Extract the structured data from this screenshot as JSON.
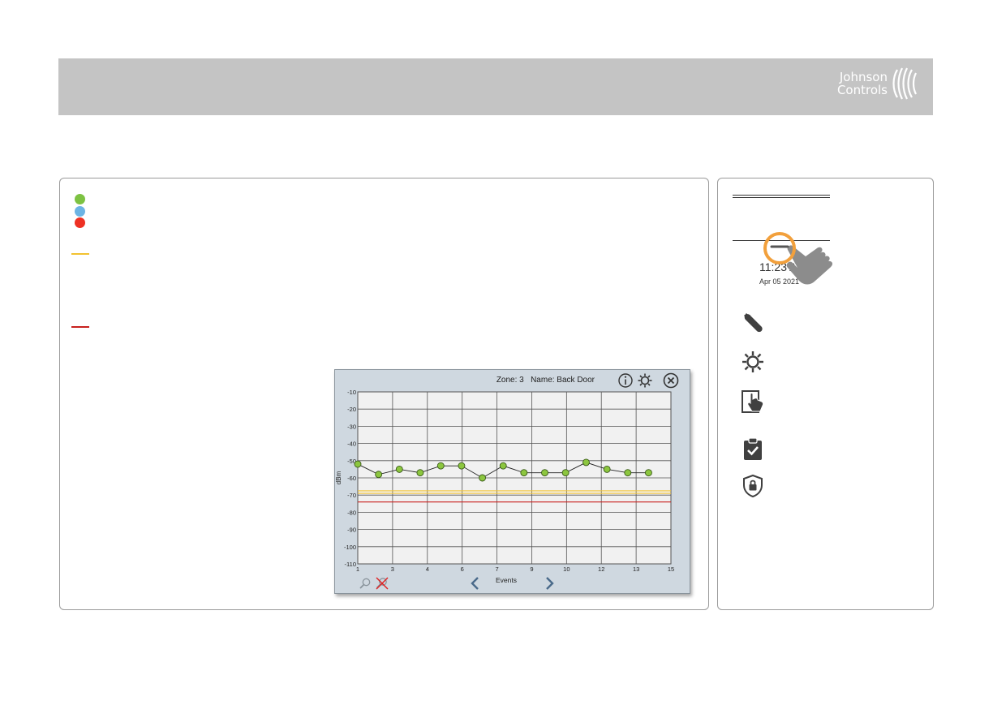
{
  "header": {
    "logo_line1": "Johnson",
    "logo_line2": "Controls"
  },
  "legend": {
    "colors": {
      "green": "#7dc242",
      "blue": "#6cb4e4",
      "red": "#ee3124",
      "yellow_line": "#f2c230",
      "red_line": "#c8201e"
    }
  },
  "chart_window": {
    "zone_label": "Zone: 3",
    "name_label": "Name: Back Door",
    "icons": [
      "info-icon",
      "gear-icon",
      "close-icon",
      "zoom-icon",
      "clear-zoom-icon",
      "chevron-left-icon",
      "chevron-right-icon"
    ]
  },
  "chart_data": {
    "type": "line",
    "title": "Zone: 3   Name: Back Door",
    "xlabel": "Events",
    "ylabel": "dBm",
    "xlim": [
      1,
      15
    ],
    "ylim": [
      -110,
      -10
    ],
    "x_ticks": [
      "1",
      "3",
      "4",
      "6",
      "7",
      "9",
      "10",
      "12",
      "13",
      "15"
    ],
    "y_ticks": [
      "-10",
      "-20",
      "-30",
      "-40",
      "-50",
      "-60",
      "-70",
      "-80",
      "-90",
      "-100",
      "-110"
    ],
    "series": [
      {
        "x": [
          1,
          1.93,
          2.86,
          3.79,
          4.71,
          5.64,
          6.57,
          7.5,
          8.43,
          9.36,
          10.29,
          11.21,
          12.14,
          13.07,
          14
        ],
        "values": [
          -52,
          -58,
          -55,
          -57,
          -53,
          -53,
          -60,
          -53,
          -57,
          -57,
          -57,
          -51,
          -55,
          -57,
          -57
        ]
      }
    ],
    "reference_lines": [
      {
        "color": "#f2c230",
        "value": -67.5
      },
      {
        "color": "#f2c230",
        "value": -69
      },
      {
        "color": "#c8201e",
        "value": -74
      }
    ],
    "grid": true
  },
  "side": {
    "time": "11:23 AM",
    "date": "Apr 05 2021",
    "icons": [
      "wrench-icon",
      "gear-icon",
      "touch-panel-icon",
      "clipboard-check-icon",
      "shield-lock-icon"
    ]
  }
}
